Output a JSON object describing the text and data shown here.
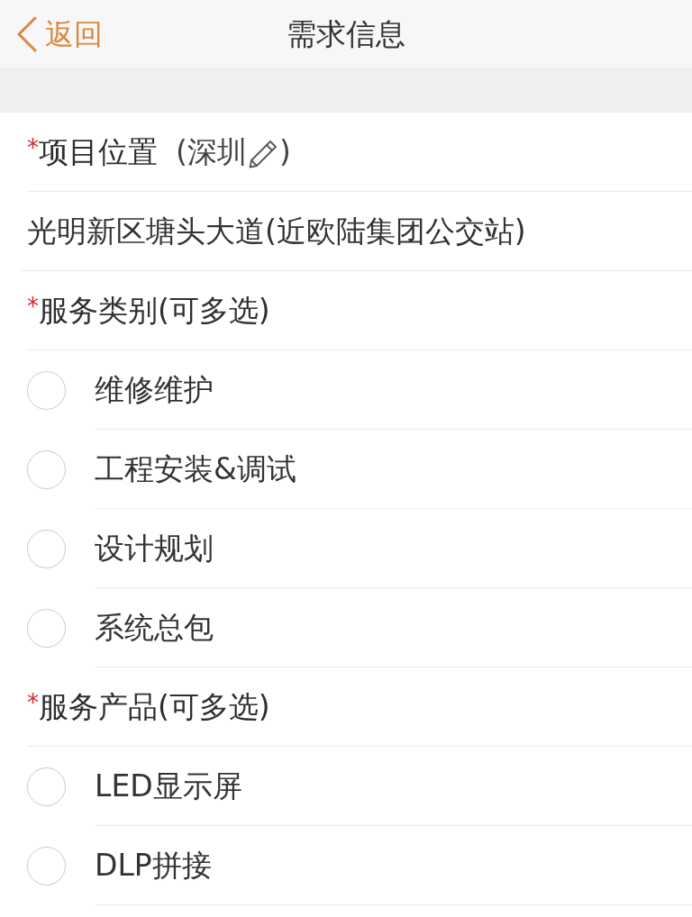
{
  "nav_bar": {
    "back_label": "返回",
    "title": "需求信息"
  },
  "location": {
    "required_mark": "*",
    "label": "项目位置",
    "city_before_icon": "(深圳",
    "city_after_icon": ")",
    "address": "光明新区塘头大道(近欧陆集团公交站)"
  },
  "sections": [
    {
      "required_mark": "*",
      "title": "服务类别(可多选)",
      "options": [
        {
          "label": "维修维护",
          "checked": false
        },
        {
          "label": "工程安装&调试",
          "checked": false
        },
        {
          "label": "设计规划",
          "checked": false
        },
        {
          "label": "系统总包",
          "checked": false
        }
      ]
    },
    {
      "required_mark": "*",
      "title": "服务产品(可多选)",
      "options": [
        {
          "label": "LED显示屏",
          "checked": false
        },
        {
          "label": "DLP拼接",
          "checked": false
        }
      ]
    }
  ]
}
